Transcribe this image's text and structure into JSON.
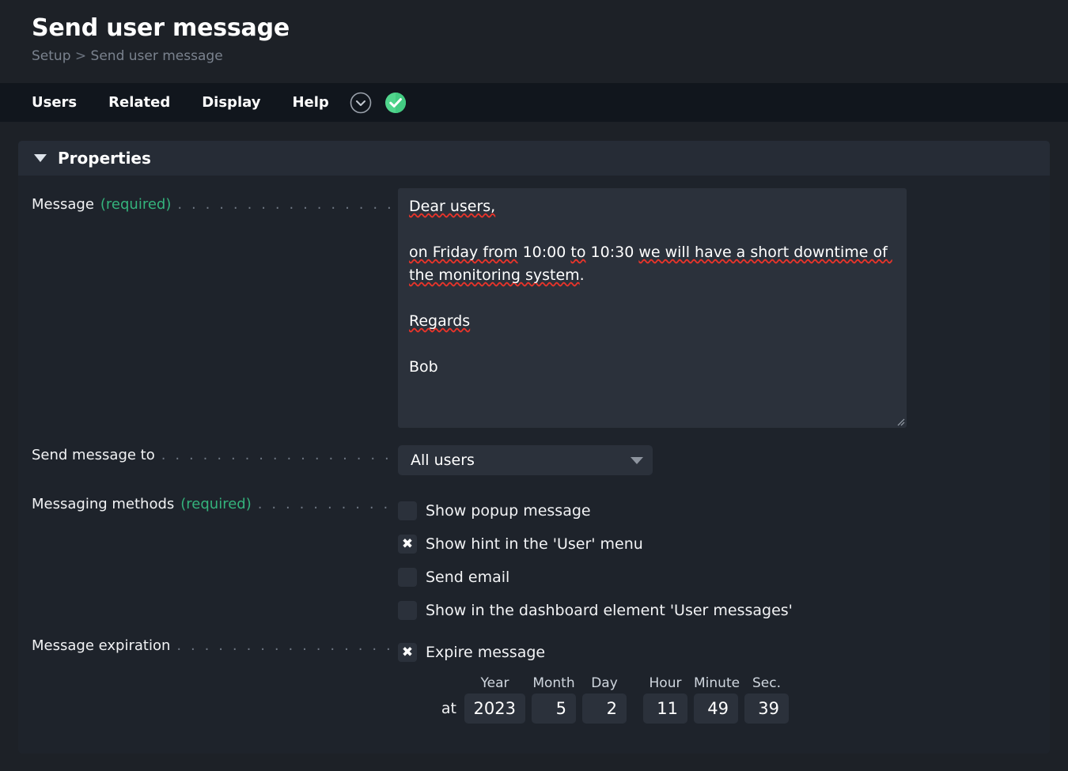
{
  "header": {
    "title": "Send user message",
    "breadcrumb": {
      "root": "Setup",
      "separator": ">",
      "current": "Send user message"
    }
  },
  "menu": {
    "items": [
      {
        "label": "Users"
      },
      {
        "label": "Related"
      },
      {
        "label": "Display"
      },
      {
        "label": "Help"
      }
    ],
    "icons": [
      {
        "name": "chevron-down-circle-icon"
      },
      {
        "name": "check-circle-icon"
      }
    ]
  },
  "panel": {
    "title": "Properties",
    "expanded": true
  },
  "form": {
    "message": {
      "label": "Message",
      "required_text": "(required)",
      "value": "Dear users,\n\non Friday from 10:00 to 10:30 we will have a short downtime of the monitoring system.\n\nRegards\n\nBob",
      "lines": {
        "l1": "Dear users,",
        "l2a": "on Friday from",
        "l2b": "10:00",
        "l2c": "to",
        "l2d": "10:30",
        "l2e": "we will have a short downtime of the monitoring system",
        "l2f": ".",
        "l3": "Regards",
        "l4": "Bob"
      }
    },
    "send_to": {
      "label": "Send message to",
      "selected": "All users",
      "options": [
        "All users"
      ]
    },
    "messaging_methods": {
      "label": "Messaging methods",
      "required_text": "(required)",
      "options": [
        {
          "label": "Show popup message",
          "checked": false
        },
        {
          "label": "Show hint in the 'User' menu",
          "checked": true
        },
        {
          "label": "Send email",
          "checked": false
        },
        {
          "label": "Show in the dashboard element 'User messages'",
          "checked": false
        }
      ]
    },
    "expiration": {
      "label": "Message expiration",
      "checkbox_label": "Expire message",
      "checked": true,
      "at_label": "at",
      "fields": [
        {
          "header": "Year",
          "value": "2023"
        },
        {
          "header": "Month",
          "value": "5"
        },
        {
          "header": "Day",
          "value": "2"
        },
        {
          "header": "Hour",
          "value": "11"
        },
        {
          "header": "Minute",
          "value": "49"
        },
        {
          "header": "Sec.",
          "value": "39"
        }
      ]
    }
  },
  "glyphs": {
    "checked_mark": "✖",
    "leader_dots": ". . . . . . . . . . . . . . . . . . . . . . . . . . . . . . . . . . . . . . . . . . . . . . . . . . . . . . . . . . . . . . . . ."
  },
  "colors": {
    "page_bg": "#1d2127",
    "menu_bg": "#11161d",
    "panel_bg": "#1e232b",
    "panel_header_bg": "#262c36",
    "field_bg": "#2b313b",
    "required_green": "#34b37c",
    "status_green": "#51d68d",
    "muted": "#7a828e",
    "spell_red": "#e8342a"
  }
}
